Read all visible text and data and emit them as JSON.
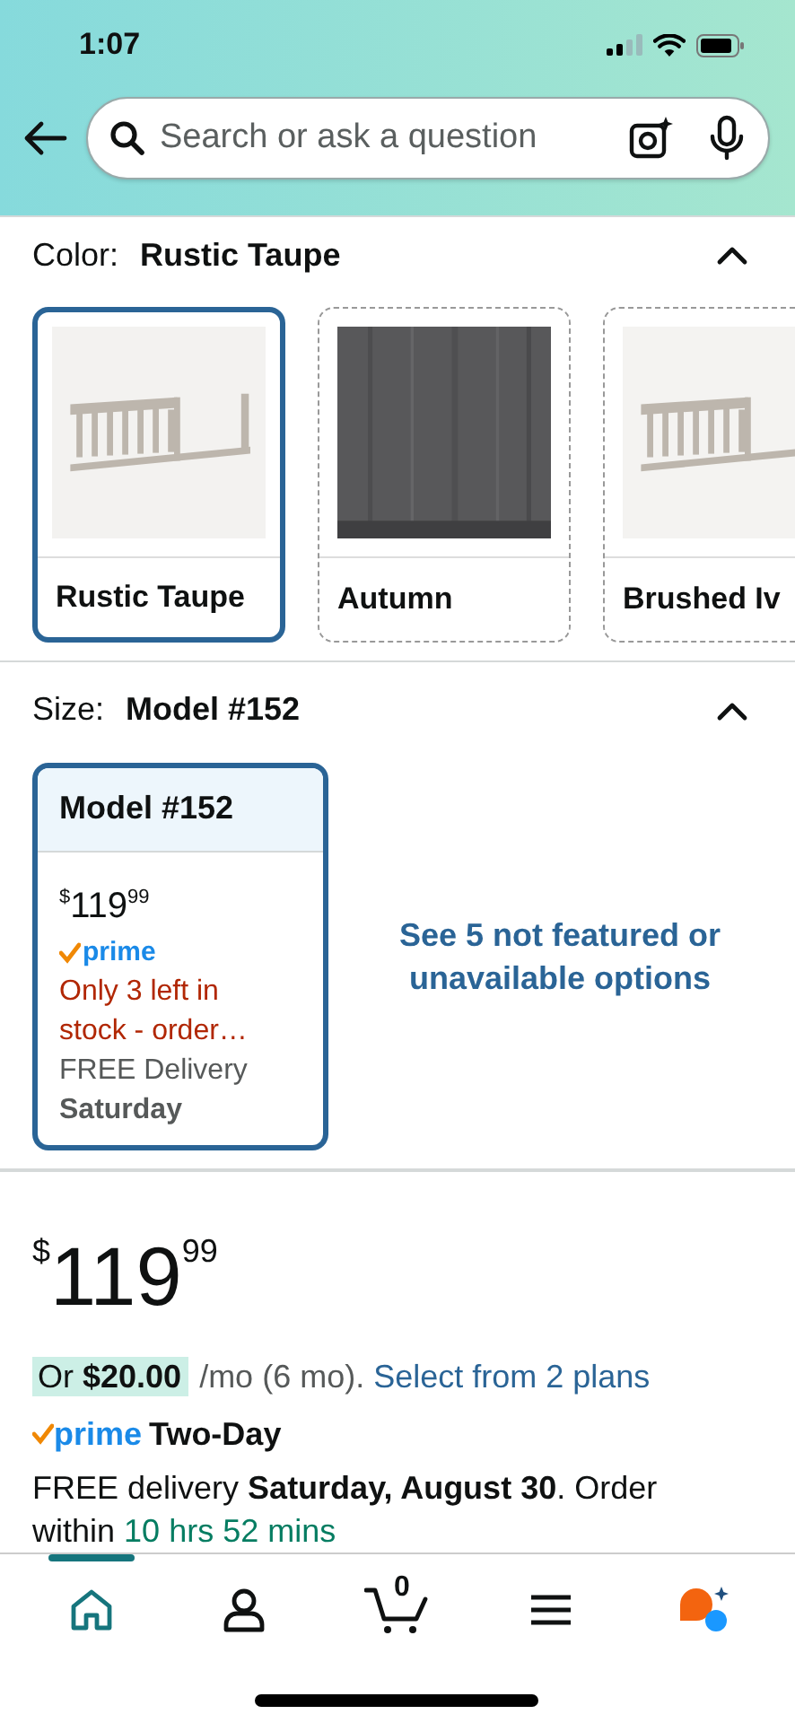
{
  "status_bar": {
    "time": "1:07"
  },
  "search": {
    "placeholder": "Search or ask a question"
  },
  "color_section": {
    "label": "Color:",
    "value": "Rustic Taupe",
    "expanded": true,
    "swatches": [
      {
        "label": "Rustic Taupe",
        "selected": true
      },
      {
        "label": "Autumn",
        "selected": false
      },
      {
        "label": "Brushed Iv",
        "selected": false
      }
    ]
  },
  "size_section": {
    "label": "Size:",
    "value": "Model #152",
    "expanded": true,
    "options": [
      {
        "title": "Model #152",
        "selected": true,
        "price": {
          "symbol": "$",
          "whole": "119",
          "fraction": "99"
        },
        "prime": "prime",
        "stock_note": "Only 3 left in stock - order…",
        "delivery": "FREE Delivery",
        "delivery_day": "Saturday"
      }
    ],
    "more_link": "See 5 not featured or unavailable options"
  },
  "price": {
    "symbol": "$",
    "whole": "119",
    "fraction": "99"
  },
  "installment": {
    "offer": "Or **$20.00**",
    "terms": "/mo (6 mo).",
    "link": "Select from 2 plans"
  },
  "prime_delivery": {
    "logo": "prime",
    "speed": "Two-Day"
  },
  "delivery": {
    "text": "FREE delivery **Saturday, August 30**. Order within",
    "countdown": "10 hrs 52 mins"
  },
  "bottom_nav": {
    "items": [
      {
        "kind": "home",
        "selected": true
      },
      {
        "kind": "account",
        "selected": false
      },
      {
        "kind": "cart",
        "selected": false,
        "badge": "0"
      },
      {
        "kind": "menu",
        "selected": false
      },
      {
        "kind": "assistant",
        "selected": false
      }
    ]
  }
}
